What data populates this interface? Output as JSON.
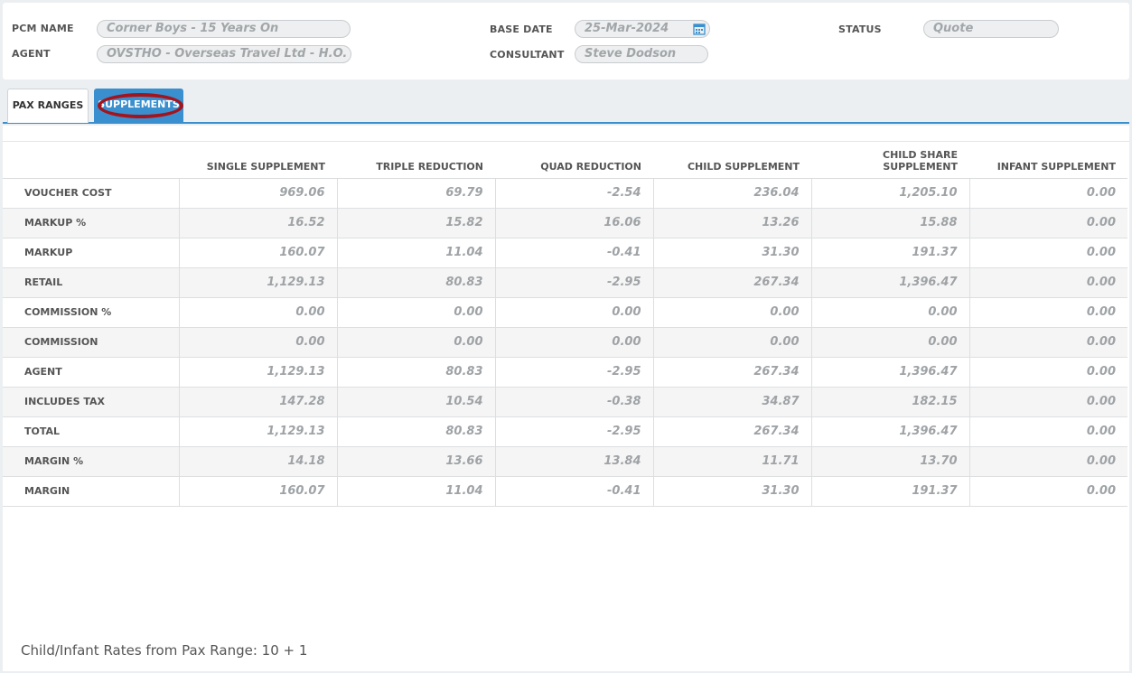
{
  "header": {
    "pcm_name_label": "PCM NAME",
    "pcm_name_value": "Corner Boys - 15 Years On",
    "agent_label": "AGENT",
    "agent_value": "OVSTHO - Overseas Travel Ltd - H.O.",
    "base_date_label": "BASE DATE",
    "base_date_value": "25-Mar-2024",
    "consultant_label": "CONSULTANT",
    "consultant_value": "Steve Dodson",
    "status_label": "STATUS",
    "status_value": "Quote",
    "calendar_icon": "calendar-icon"
  },
  "tabs": [
    {
      "label": "PAX RANGES",
      "active": false
    },
    {
      "label": "SUPPLEMENTS",
      "active": true
    }
  ],
  "columns": [
    "",
    "SINGLE SUPPLEMENT",
    "TRIPLE REDUCTION",
    "QUAD REDUCTION",
    "CHILD SUPPLEMENT",
    "CHILD SHARE SUPPLEMENT",
    "INFANT SUPPLEMENT"
  ],
  "rows": [
    [
      "VOUCHER COST",
      "969.06",
      "69.79",
      "-2.54",
      "236.04",
      "1,205.10",
      "0.00"
    ],
    [
      "MARKUP %",
      "16.52",
      "15.82",
      "16.06",
      "13.26",
      "15.88",
      "0.00"
    ],
    [
      "MARKUP",
      "160.07",
      "11.04",
      "-0.41",
      "31.30",
      "191.37",
      "0.00"
    ],
    [
      "RETAIL",
      "1,129.13",
      "80.83",
      "-2.95",
      "267.34",
      "1,396.47",
      "0.00"
    ],
    [
      "COMMISSION %",
      "0.00",
      "0.00",
      "0.00",
      "0.00",
      "0.00",
      "0.00"
    ],
    [
      "COMMISSION",
      "0.00",
      "0.00",
      "0.00",
      "0.00",
      "0.00",
      "0.00"
    ],
    [
      "AGENT",
      "1,129.13",
      "80.83",
      "-2.95",
      "267.34",
      "1,396.47",
      "0.00"
    ],
    [
      "INCLUDES TAX",
      "147.28",
      "10.54",
      "-0.38",
      "34.87",
      "182.15",
      "0.00"
    ],
    [
      "TOTAL",
      "1,129.13",
      "80.83",
      "-2.95",
      "267.34",
      "1,396.47",
      "0.00"
    ],
    [
      "MARGIN %",
      "14.18",
      "13.66",
      "13.84",
      "11.71",
      "13.70",
      "0.00"
    ],
    [
      "MARGIN",
      "160.07",
      "11.04",
      "-0.41",
      "31.30",
      "191.37",
      "0.00"
    ]
  ],
  "footer": "Child/Infant Rates from Pax Range: 10 + 1",
  "colors": {
    "accent": "#3a8fcf",
    "highlight_circle": "#a4141c"
  }
}
